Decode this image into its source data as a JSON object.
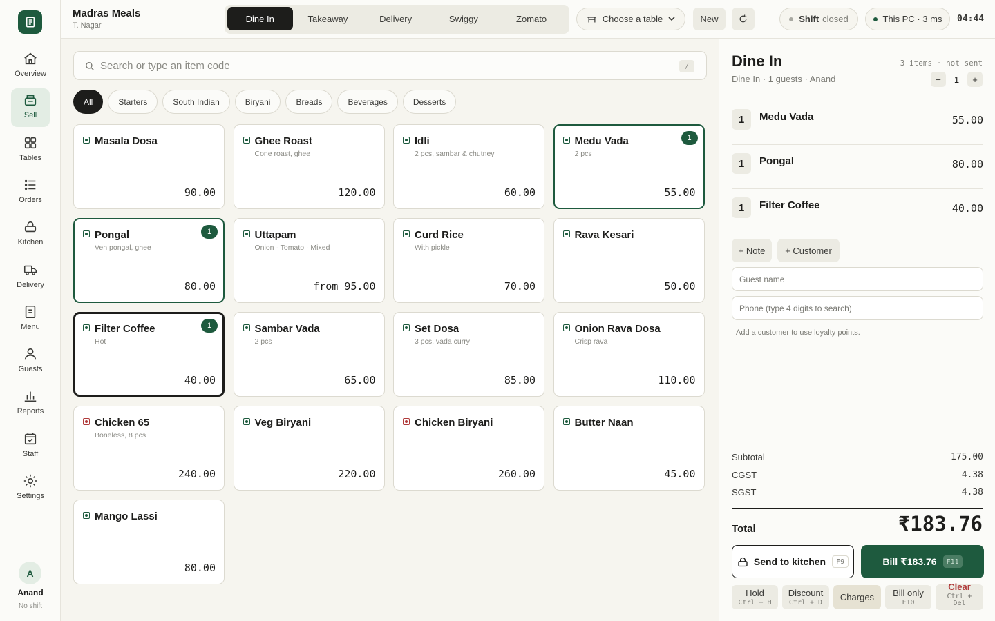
{
  "nav": {
    "items": [
      {
        "label": "Overview",
        "icon": "home-icon"
      },
      {
        "label": "Sell",
        "icon": "register-icon",
        "active": true
      },
      {
        "label": "Tables",
        "icon": "grid-icon"
      },
      {
        "label": "Orders",
        "icon": "list-icon"
      },
      {
        "label": "Kitchen",
        "icon": "basket-icon"
      },
      {
        "label": "Delivery",
        "icon": "truck-icon"
      },
      {
        "label": "Menu",
        "icon": "document-icon"
      },
      {
        "label": "Guests",
        "icon": "person-icon"
      },
      {
        "label": "Reports",
        "icon": "bar-chart-icon"
      },
      {
        "label": "Staff",
        "icon": "calendar-check-icon"
      },
      {
        "label": "Settings",
        "icon": "gear-icon"
      }
    ],
    "user": {
      "initial": "A",
      "name": "Anand",
      "shift": "No shift"
    }
  },
  "header": {
    "store_name": "Madras Meals",
    "store_location": "T. Nagar",
    "modes": [
      "Dine In",
      "Takeaway",
      "Delivery",
      "Swiggy",
      "Zomato"
    ],
    "active_mode": "Dine In",
    "table_label": "Choose a table",
    "new_label": "New",
    "shift_label": "Shift",
    "shift_status": "closed",
    "device_status": "This PC · 3 ms",
    "time": "04:44",
    "colors": {
      "online": "#1e5a3e",
      "offline": "#a9a9a2"
    }
  },
  "search": {
    "placeholder": "Search or type an item code",
    "shortcut": "/"
  },
  "categories": [
    "All",
    "Starters",
    "South Indian",
    "Biryani",
    "Breads",
    "Beverages",
    "Desserts"
  ],
  "active_category": "All",
  "items": [
    {
      "name": "Masala Dosa",
      "desc": "",
      "price": "90.00",
      "veg": true
    },
    {
      "name": "Ghee Roast",
      "desc": "Cone roast, ghee",
      "price": "120.00",
      "veg": true
    },
    {
      "name": "Idli",
      "desc": "2 pcs, sambar & chutney",
      "price": "60.00",
      "veg": true
    },
    {
      "name": "Medu Vada",
      "desc": "2 pcs",
      "price": "55.00",
      "veg": true,
      "qty": "1"
    },
    {
      "name": "Pongal",
      "desc": "Ven pongal, ghee",
      "price": "80.00",
      "veg": true,
      "qty": "1"
    },
    {
      "name": "Uttapam",
      "desc": "Onion · Tomato · Mixed",
      "price": "from 95.00",
      "veg": true
    },
    {
      "name": "Curd Rice",
      "desc": "With pickle",
      "price": "70.00",
      "veg": true
    },
    {
      "name": "Rava Kesari",
      "desc": "",
      "price": "50.00",
      "veg": true
    },
    {
      "name": "Filter Coffee",
      "desc": "Hot",
      "price": "40.00",
      "veg": true,
      "qty": "1",
      "focused": true
    },
    {
      "name": "Sambar Vada",
      "desc": "2 pcs",
      "price": "65.00",
      "veg": true
    },
    {
      "name": "Set Dosa",
      "desc": "3 pcs, vada curry",
      "price": "85.00",
      "veg": true
    },
    {
      "name": "Onion Rava Dosa",
      "desc": "Crisp rava",
      "price": "110.00",
      "veg": true
    },
    {
      "name": "Chicken 65",
      "desc": "Boneless, 8 pcs",
      "price": "240.00",
      "veg": false
    },
    {
      "name": "Veg Biryani",
      "desc": "",
      "price": "220.00",
      "veg": true
    },
    {
      "name": "Chicken Biryani",
      "desc": "",
      "price": "260.00",
      "veg": false
    },
    {
      "name": "Butter Naan",
      "desc": "",
      "price": "45.00",
      "veg": true
    },
    {
      "name": "Mango Lassi",
      "desc": "",
      "price": "80.00",
      "veg": true
    }
  ],
  "cart": {
    "title": "Dine In",
    "subtitle": "Dine In · 1 guests · Anand",
    "meta": "3 items · not sent",
    "guests": "1",
    "minus": "−",
    "plus": "+",
    "lines": [
      {
        "qty": "1",
        "name": "Medu Vada",
        "price": "55.00"
      },
      {
        "qty": "1",
        "name": "Pongal",
        "price": "80.00"
      },
      {
        "qty": "1",
        "name": "Filter Coffee",
        "price": "40.00"
      }
    ],
    "note_label": "+ Note",
    "customer_label": "+ Customer",
    "guest_name_placeholder": "Guest name",
    "phone_placeholder": "Phone (type 4 digits to search)",
    "hint": "Add a customer to use loyalty points.",
    "subtotal_label": "Subtotal",
    "subtotal": "175.00",
    "cgst_label": "CGST",
    "cgst": "4.38",
    "sgst_label": "SGST",
    "sgst": "4.38",
    "total_label": "Total",
    "total": "₹183.76",
    "send_label": "Send to kitchen",
    "send_key": "F9",
    "bill_label": "Bill ₹183.76",
    "bill_key": "F11",
    "actions": [
      {
        "label": "Hold",
        "shortcut": "Ctrl + H"
      },
      {
        "label": "Discount",
        "shortcut": "Ctrl + D"
      },
      {
        "label": "Charges",
        "shortcut": ""
      },
      {
        "label": "Bill only",
        "shortcut": "F10"
      },
      {
        "label": "Clear",
        "shortcut": "Ctrl + Del"
      }
    ],
    "colors": {
      "primary": "#1e5a3e",
      "danger": "#b03a3a"
    }
  }
}
